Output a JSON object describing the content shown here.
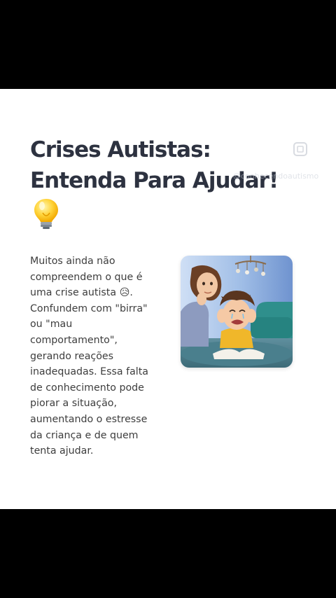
{
  "post": {
    "title_line1": "Crises Autistas:",
    "title_line2": "Entenda Para Ajudar!",
    "title_emoji": "💡",
    "body": "Muitos ainda não compreendem o que é uma crise autista 😥. Confundem com \"birra\" ou \"mau comportamento\", gerando reações inadequadas. Essa falta de conhecimento pode piorar a situação, aumentando o estresse da criança e de quem tenta ajudar."
  },
  "watermark": {
    "handle": "@conhecendoautismo",
    "icon": "platform-logo-icon"
  },
  "icons": {
    "bulb": "lightbulb-icon"
  },
  "colors": {
    "background_bars": "#000000",
    "card": "#ffffff",
    "title": "#2d3240",
    "body": "#3d3d3d"
  }
}
